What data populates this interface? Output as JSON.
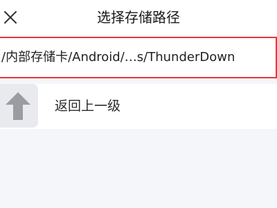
{
  "header": {
    "title": "选择存储路径",
    "close_icon": "close-icon"
  },
  "path_bar": {
    "current_path": "/内部存储卡/Android/…s/ThunderDown",
    "highlight_color": "#e53935"
  },
  "navigation": {
    "up_label": "返回上一级",
    "up_icon": "arrow-up-icon",
    "icon_color": "#9a9ca2"
  }
}
